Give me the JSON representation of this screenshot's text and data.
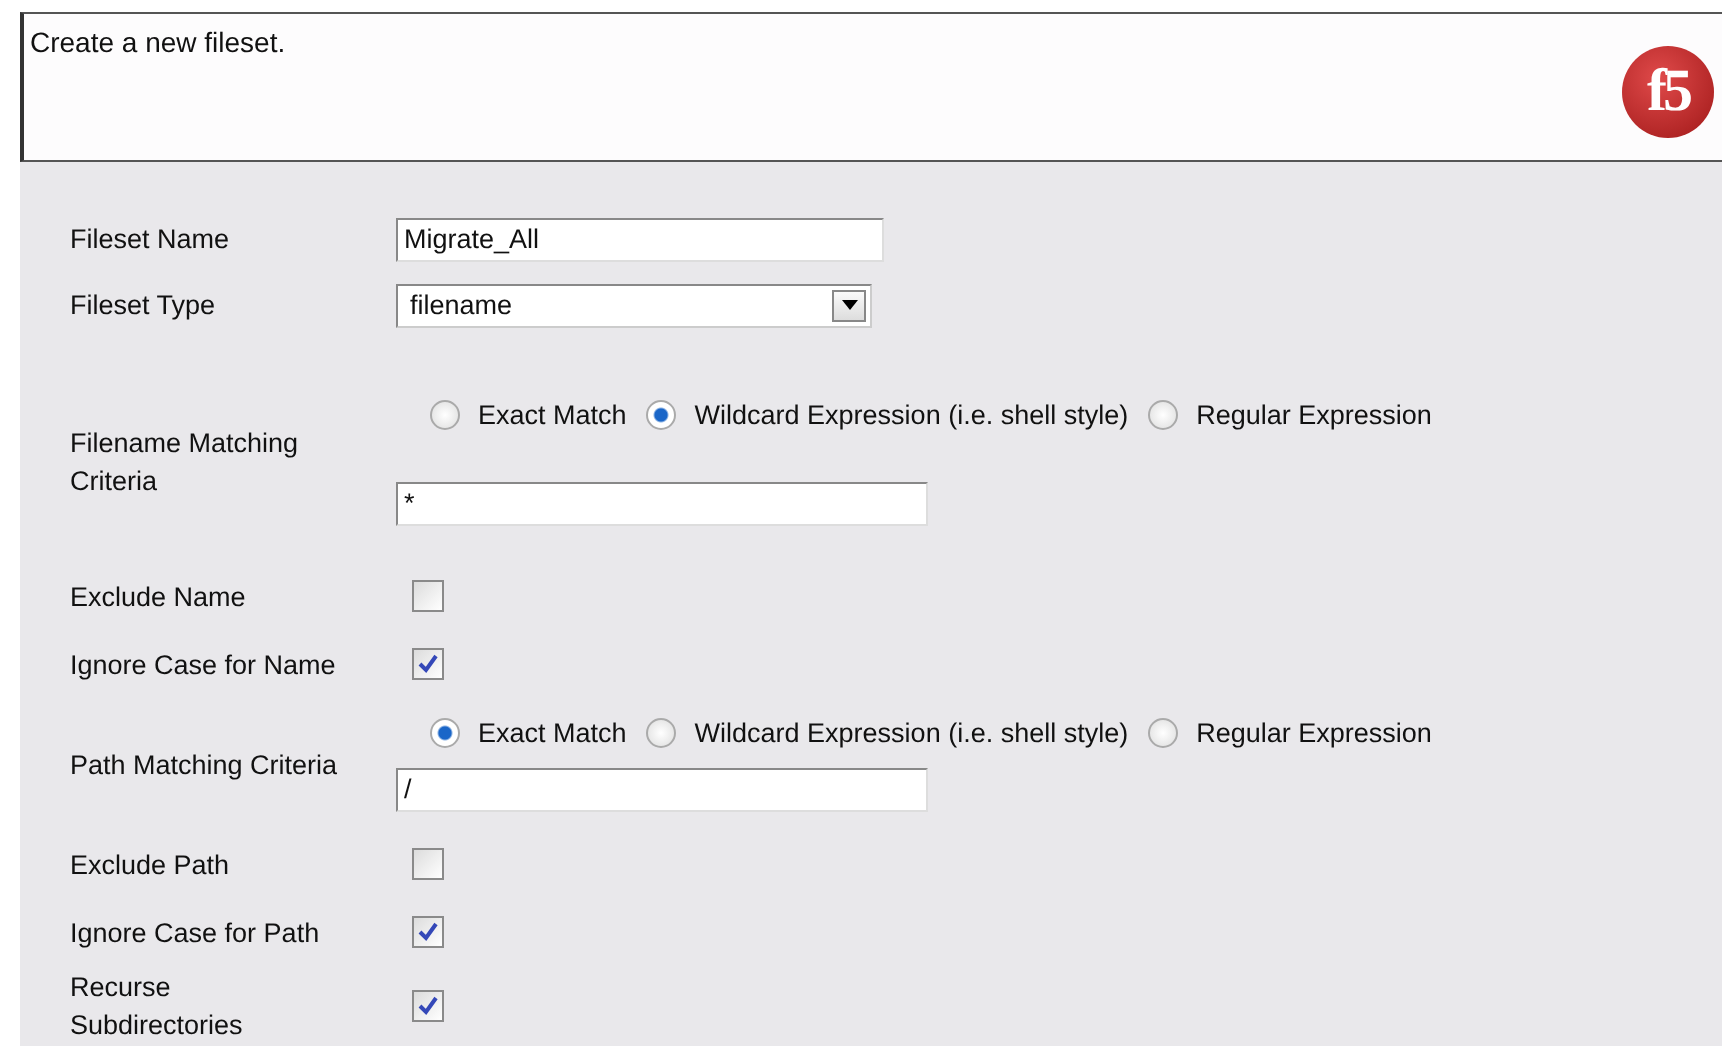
{
  "header": {
    "description": "Create a new fileset.",
    "logo": "f5"
  },
  "fields": [
    {
      "kind": "text",
      "label": "Fileset Name",
      "value": "Migrate_All"
    },
    {
      "kind": "select",
      "label": "Fileset Type",
      "value": "filename"
    },
    {
      "kind": "radio_group",
      "label": "Filename Matching Criteria",
      "options": [
        {
          "label": "Exact Match",
          "selected": false
        },
        {
          "label": "Wildcard Expression (i.e. shell style)",
          "selected": true
        },
        {
          "label": "Regular Expression",
          "selected": false
        }
      ],
      "value": "*"
    },
    {
      "kind": "checkbox",
      "label": "Exclude Name",
      "checked": false
    },
    {
      "kind": "checkbox",
      "label": "Ignore Case for Name",
      "checked": true
    },
    {
      "kind": "radio_group",
      "label": "Path Matching Criteria",
      "options": [
        {
          "label": "Exact Match",
          "selected": true
        },
        {
          "label": "Wildcard Expression (i.e. shell style)",
          "selected": false
        },
        {
          "label": "Regular Expression",
          "selected": false
        }
      ],
      "value": "/"
    },
    {
      "kind": "checkbox",
      "label": "Exclude Path",
      "checked": false
    },
    {
      "kind": "checkbox",
      "label": "Ignore Case for Path",
      "checked": true
    },
    {
      "kind": "checkbox",
      "label": "Recurse Subdirectories",
      "checked": true
    }
  ]
}
